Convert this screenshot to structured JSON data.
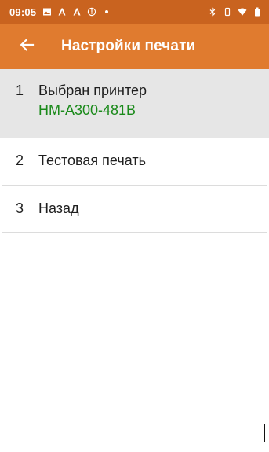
{
  "status_bar": {
    "time": "09:05",
    "left_icons": [
      "image-icon",
      "pen-a-icon",
      "pen-a-icon",
      "info-circle-icon",
      "dot-icon"
    ],
    "right_icons": [
      "bluetooth-icon",
      "vibrate-icon",
      "wifi-icon",
      "battery-icon"
    ]
  },
  "app_bar": {
    "title": "Настройки печати",
    "back_icon": "arrow-left-icon",
    "color": "#e07b2f"
  },
  "menu": {
    "items": [
      {
        "number": "1",
        "label": "Выбран принтер",
        "subtitle": "HM-A300-481B",
        "selected": true
      },
      {
        "number": "2",
        "label": "Тестовая печать"
      },
      {
        "number": "3",
        "label": "Назад"
      }
    ]
  },
  "colors": {
    "status_bar": "#c9631f",
    "app_bar": "#e07b2f",
    "selected_row": "#e6e6e6",
    "printer_name": "#1a8a1a"
  }
}
